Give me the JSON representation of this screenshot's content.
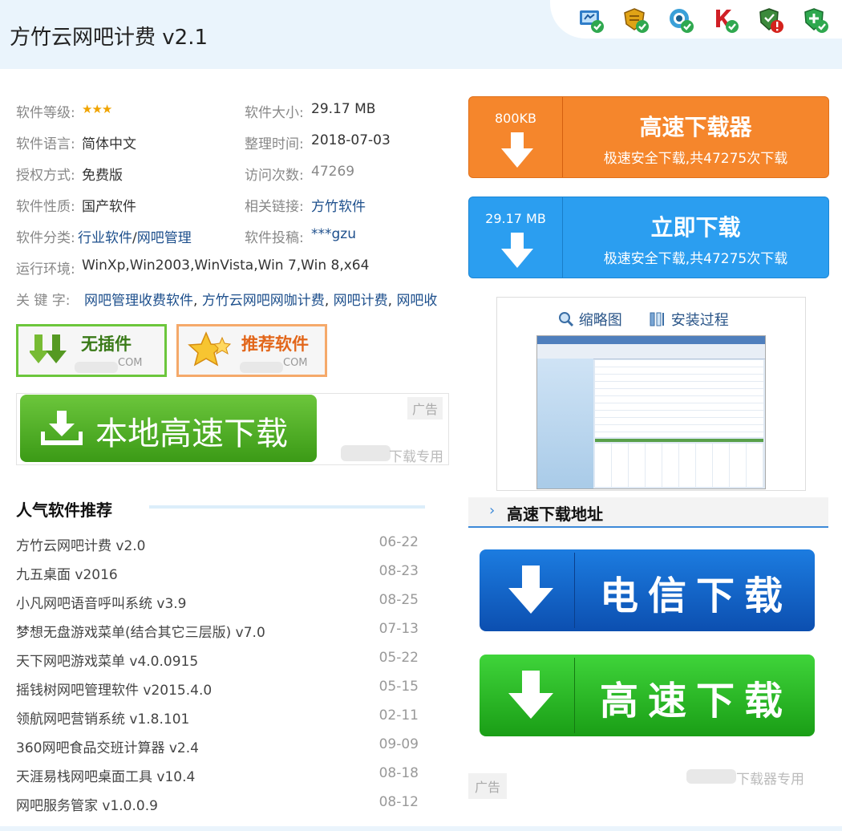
{
  "header": {
    "title": "方竹云网吧计费 v2.1",
    "security_icons": [
      "computer-check-icon",
      "shield-gold-icon",
      "eye-scan-icon",
      "k-antivirus-icon",
      "warning-shield-icon",
      "green-plus-shield-icon"
    ]
  },
  "info": {
    "level_label": "软件等级:",
    "level_stars": "★★★",
    "size_label": "软件大小:",
    "size_value": "29.17 MB",
    "lang_label": "软件语言:",
    "lang_value": "简体中文",
    "date_label": "整理时间:",
    "date_value": "2018-07-03",
    "license_label": "授权方式:",
    "license_value": "免费版",
    "visits_label": "访问次数:",
    "visits_value": "47269",
    "nature_label": "软件性质:",
    "nature_value": "国产软件",
    "related_label": "相关链接:",
    "related_value": "方竹软件",
    "category_label": "软件分类:",
    "category_value1": "行业软件",
    "category_sep": "/",
    "category_value2": "网吧管理",
    "submit_label": "软件投稿:",
    "submit_value": "***gzu",
    "env_label": "运行环境:",
    "env_value": "WinXp,Win2003,WinVista,Win 7,Win 8,x64",
    "keywords_label": "关 键 字:",
    "keywords": [
      "网吧管理收费软件",
      "方竹云网吧网咖计费",
      "网吧计费",
      "网吧收"
    ]
  },
  "badges": {
    "noplugin": "无插件",
    "recommend": "推荐软件",
    "com": "COM"
  },
  "ad1": {
    "label": "本地高速下载",
    "tag": "广告",
    "footer": "下载专用"
  },
  "popular": {
    "title": "人气软件推荐",
    "items": [
      {
        "name": "方竹云网吧计费 v2.0",
        "date": "06-22"
      },
      {
        "name": "九五桌面 v2016",
        "date": "08-23"
      },
      {
        "name": "小凡网吧语音呼叫系统 v3.9",
        "date": "08-25"
      },
      {
        "name": "梦想无盘游戏菜单(结合其它三层版) v7.0",
        "date": "07-13"
      },
      {
        "name": "天下网吧游戏菜单 v4.0.0915",
        "date": "05-22"
      },
      {
        "name": "摇钱树网吧管理软件 v2015.4.0",
        "date": "05-15"
      },
      {
        "name": "领航网吧营销系统 v1.8.101",
        "date": "02-11"
      },
      {
        "name": "360网吧食品交班计算器 v2.4",
        "date": "09-09"
      },
      {
        "name": "天涯易栈网吧桌面工具 v10.4",
        "date": "08-18"
      },
      {
        "name": "网吧服务管家 v1.0.0.9",
        "date": "08-12"
      }
    ]
  },
  "downloader": {
    "size": "800KB",
    "title": "高速下载器",
    "subtitle": "极速安全下载,共47275次下载",
    "color": "#f5862c"
  },
  "direct": {
    "size": "29.17 MB",
    "title": "立即下载",
    "subtitle": "极速安全下载,共47275次下载",
    "color": "#2b9ef0"
  },
  "preview": {
    "tab1": "缩略图",
    "tab2": "安装过程"
  },
  "highspeed": {
    "title": "高速下载地址"
  },
  "buttons": {
    "telecom": "电信下载",
    "fast": "高速下载"
  },
  "ad2": {
    "tag": "广告",
    "footer": "下载器专用"
  }
}
